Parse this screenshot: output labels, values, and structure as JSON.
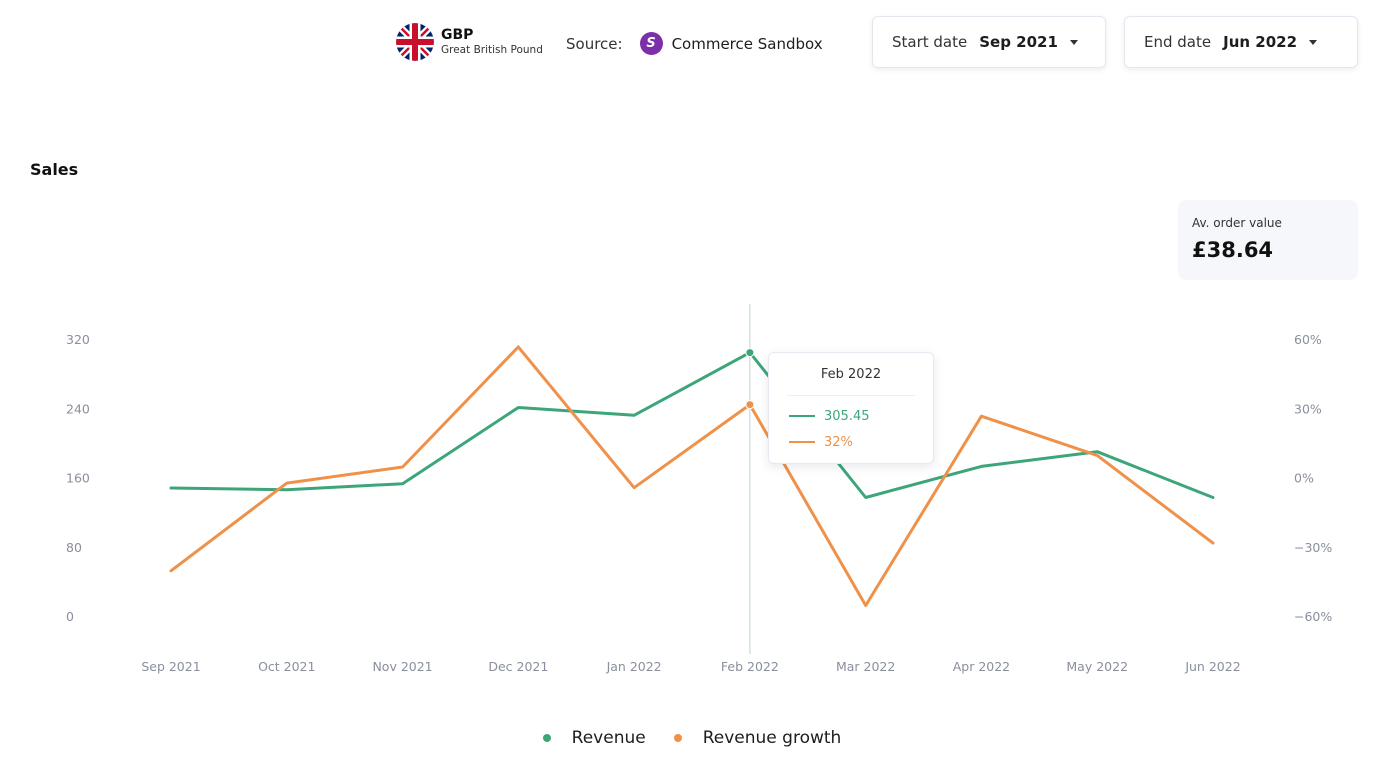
{
  "header": {
    "currency_code": "GBP",
    "currency_name": "Great British Pound",
    "source_label": "Source:",
    "source_name": "Commerce Sandbox",
    "start_date_label": "Start date",
    "start_date_value": "Sep 2021",
    "end_date_label": "End date",
    "end_date_value": "Jun 2022"
  },
  "section_title": "Sales",
  "kpi": {
    "label": "Av. order value",
    "value": "£38.64"
  },
  "tooltip": {
    "title": "Feb 2022",
    "revenue": "305.45",
    "growth": "32%"
  },
  "colors": {
    "revenue": "#3da57a",
    "growth": "#f0914a",
    "axis_text": "#8a8f9c",
    "hover_line": "#bfd3dc"
  },
  "chart_data": {
    "type": "line",
    "categories": [
      "Sep 2021",
      "Oct 2021",
      "Nov 2021",
      "Dec 2021",
      "Jan 2022",
      "Feb 2022",
      "Mar 2022",
      "Apr 2022",
      "May 2022",
      "Jun 2022"
    ],
    "series": [
      {
        "name": "Revenue",
        "axis": "left",
        "values": [
          149,
          147,
          154,
          242,
          233,
          305.45,
          138,
          174,
          191,
          138
        ]
      },
      {
        "name": "Revenue growth",
        "axis": "right",
        "values": [
          -40,
          -2,
          5,
          57,
          -4,
          32,
          -55,
          27,
          10,
          -28
        ]
      }
    ],
    "y_left": {
      "ticks": [
        0,
        80,
        160,
        240,
        320
      ],
      "tick_labels": [
        "0",
        "80",
        "160",
        "240",
        "320"
      ],
      "range": [
        0,
        320
      ]
    },
    "y_right": {
      "ticks": [
        -60,
        -30,
        0,
        30,
        60
      ],
      "tick_labels": [
        "−60%",
        "−30%",
        "0%",
        "30%",
        "60%"
      ],
      "range": [
        -60,
        60
      ]
    },
    "hover_category": "Feb 2022",
    "grid": false,
    "legend_position": "bottom-center"
  }
}
